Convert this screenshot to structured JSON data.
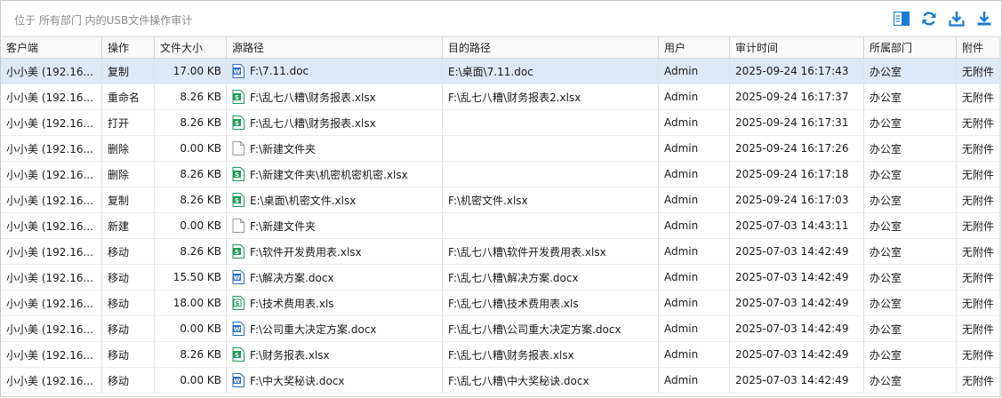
{
  "location": "位于 所有部门 内的USB文件操作审计",
  "toolbar": {
    "icons": [
      "columns-icon",
      "refresh-icon",
      "download-icon",
      "export-icon"
    ],
    "color": "#1a7bd6"
  },
  "columns": [
    "客户端",
    "操作",
    "文件大小",
    "源路径",
    "目的路径",
    "用户",
    "审计时间",
    "所属部门",
    "附件"
  ],
  "rows": [
    {
      "client": "小小美 (192.16...",
      "op": "复制",
      "size": "17.00 KB",
      "icon": "word-icon",
      "src": "F:\\7.11.doc",
      "dst": "E:\\桌面\\7.11.doc",
      "user": "Admin",
      "time": "2025-09-24 16:17:43",
      "dept": "办公室",
      "att": "无附件"
    },
    {
      "client": "小小美 (192.16...",
      "op": "重命名",
      "size": "8.26 KB",
      "icon": "excel-icon",
      "src": "F:\\乱七八糟\\财务报表.xlsx",
      "dst": "F:\\乱七八糟\\财务报表2.xlsx",
      "user": "Admin",
      "time": "2025-09-24 16:17:37",
      "dept": "办公室",
      "att": "无附件"
    },
    {
      "client": "小小美 (192.16...",
      "op": "打开",
      "size": "8.26 KB",
      "icon": "excel-icon",
      "src": "F:\\乱七八糟\\财务报表.xlsx",
      "dst": "",
      "user": "Admin",
      "time": "2025-09-24 16:17:31",
      "dept": "办公室",
      "att": "无附件"
    },
    {
      "client": "小小美 (192.16...",
      "op": "删除",
      "size": "0.00 KB",
      "icon": "blank-file-icon",
      "src": "F:\\新建文件夹",
      "dst": "",
      "user": "Admin",
      "time": "2025-09-24 16:17:26",
      "dept": "办公室",
      "att": "无附件"
    },
    {
      "client": "小小美 (192.16...",
      "op": "删除",
      "size": "8.26 KB",
      "icon": "excel-icon",
      "src": "F:\\新建文件夹\\机密机密机密.xlsx",
      "dst": "",
      "user": "Admin",
      "time": "2025-09-24 16:17:18",
      "dept": "办公室",
      "att": "无附件"
    },
    {
      "client": "小小美 (192.16...",
      "op": "复制",
      "size": "8.26 KB",
      "icon": "excel-icon",
      "src": "E:\\桌面\\机密文件.xlsx",
      "dst": "F:\\机密文件.xlsx",
      "user": "Admin",
      "time": "2025-09-24 16:17:03",
      "dept": "办公室",
      "att": "无附件"
    },
    {
      "client": "小小美 (192.16...",
      "op": "新建",
      "size": "0.00 KB",
      "icon": "blank-file-icon",
      "src": "F:\\新建文件夹",
      "dst": "",
      "user": "Admin",
      "time": "2025-07-03 14:43:11",
      "dept": "办公室",
      "att": "无附件"
    },
    {
      "client": "小小美 (192.16...",
      "op": "移动",
      "size": "8.26 KB",
      "icon": "excel-icon",
      "src": "F:\\软件开发费用表.xlsx",
      "dst": "F:\\乱七八糟\\软件开发费用表.xlsx",
      "user": "Admin",
      "time": "2025-07-03 14:42:49",
      "dept": "办公室",
      "att": "无附件"
    },
    {
      "client": "小小美 (192.16...",
      "op": "移动",
      "size": "15.50 KB",
      "icon": "word-icon",
      "src": "F:\\解决方案.docx",
      "dst": "F:\\乱七八糟\\解决方案.docx",
      "user": "Admin",
      "time": "2025-07-03 14:42:49",
      "dept": "办公室",
      "att": "无附件"
    },
    {
      "client": "小小美 (192.16...",
      "op": "移动",
      "size": "18.00 KB",
      "icon": "excel-old-icon",
      "src": "F:\\技术费用表.xls",
      "dst": "F:\\乱七八糟\\技术费用表.xls",
      "user": "Admin",
      "time": "2025-07-03 14:42:49",
      "dept": "办公室",
      "att": "无附件"
    },
    {
      "client": "小小美 (192.16...",
      "op": "移动",
      "size": "0.00 KB",
      "icon": "word-icon",
      "src": "F:\\公司重大决定方案.docx",
      "dst": "F:\\乱七八糟\\公司重大决定方案.docx",
      "user": "Admin",
      "time": "2025-07-03 14:42:49",
      "dept": "办公室",
      "att": "无附件"
    },
    {
      "client": "小小美 (192.16...",
      "op": "移动",
      "size": "8.26 KB",
      "icon": "excel-icon",
      "src": "F:\\财务报表.xlsx",
      "dst": "F:\\乱七八糟\\财务报表.xlsx",
      "user": "Admin",
      "time": "2025-07-03 14:42:49",
      "dept": "办公室",
      "att": "无附件"
    },
    {
      "client": "小小美 (192.16...",
      "op": "移动",
      "size": "0.00 KB",
      "icon": "word-icon",
      "src": "F:\\中大奖秘诀.docx",
      "dst": "F:\\乱七八糟\\中大奖秘诀.docx",
      "user": "Admin",
      "time": "2025-07-03 14:42:49",
      "dept": "办公室",
      "att": "无附件"
    }
  ]
}
